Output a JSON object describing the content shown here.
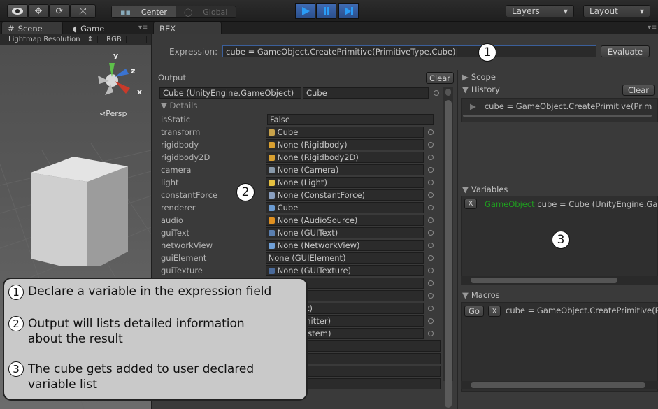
{
  "toolbar": {
    "tools": [
      "eye-icon",
      "move-icon",
      "rotate-icon",
      "scale-icon"
    ],
    "pivot_center": "Center",
    "pivot_global": "Global",
    "layers_label": "Layers",
    "layout_label": "Layout"
  },
  "tabs": {
    "scene": "Scene",
    "game": "Game",
    "rex": "REX"
  },
  "scene": {
    "lightmap_label": "Lightmap Resolution",
    "rgb_label": "RGB",
    "persp_label": "Persp",
    "axis_x": "x",
    "axis_y": "y",
    "axis_z": "z"
  },
  "rex": {
    "expression_label": "Expression:",
    "expression_value": "cube = GameObject.CreatePrimitive(PrimitiveType.Cube)",
    "evaluate_label": "Evaluate",
    "output_label": "Output",
    "clear_label": "Clear",
    "result_type": "Cube (UnityEngine.GameObject)",
    "result_name": "Cube",
    "details_label": "Details",
    "properties": [
      {
        "name": "isStatic",
        "value": "False",
        "icon": ""
      },
      {
        "name": "transform",
        "value": "Cube",
        "icon": "transform-icon"
      },
      {
        "name": "rigidbody",
        "value": "None (Rigidbody)",
        "icon": "rigidbody-icon"
      },
      {
        "name": "rigidbody2D",
        "value": "None (Rigidbody2D)",
        "icon": "rigidbody-icon"
      },
      {
        "name": "camera",
        "value": "None (Camera)",
        "icon": "camera-icon"
      },
      {
        "name": "light",
        "value": "None (Light)",
        "icon": "light-icon"
      },
      {
        "name": "constantForce",
        "value": "None (ConstantForce)",
        "icon": "force-icon"
      },
      {
        "name": "renderer",
        "value": "Cube",
        "icon": "renderer-icon"
      },
      {
        "name": "audio",
        "value": "None (AudioSource)",
        "icon": "audio-icon"
      },
      {
        "name": "guiText",
        "value": "None (GUIText)",
        "icon": "guitext-icon"
      },
      {
        "name": "networkView",
        "value": "None (NetworkView)",
        "icon": "network-icon"
      },
      {
        "name": "guiElement",
        "value": "None (GUIElement)",
        "icon": ""
      },
      {
        "name": "guiTexture",
        "value": "None (GUITexture)",
        "icon": "guitexture-icon"
      }
    ],
    "partial_values": [
      "",
      "llider2D)",
      "HingeJoint)",
      "ParticleEmitter)",
      "ParticleSystem)"
    ],
    "scope_label": "Scope",
    "history_label": "History",
    "history_clear_label": "Clear",
    "history_item": "cube = GameObject.CreatePrimitive(Prim",
    "variables_label": "Variables",
    "variable_type": "GameObject",
    "variable_text": "cube = Cube (UnityEngine.Ga",
    "var_remove": "X",
    "macros_label": "Macros",
    "macro_go": "Go",
    "macro_remove": "X",
    "macro_text": "cube = GameObject.CreatePrimitive(P"
  },
  "annotations": {
    "badge_1": "1",
    "badge_2": "2",
    "badge_3": "3",
    "items": [
      {
        "num": "1",
        "text": "Declare a variable in the expression field"
      },
      {
        "num": "2",
        "text": "Output will lists detailed information about the result"
      },
      {
        "num": "3",
        "text": "The cube gets added to user declared variable list"
      }
    ]
  },
  "colors": {
    "accent_blue": "#2a9cf6",
    "variable_green": "#1f9e1f",
    "callout_bg": "#c9c9c9"
  }
}
